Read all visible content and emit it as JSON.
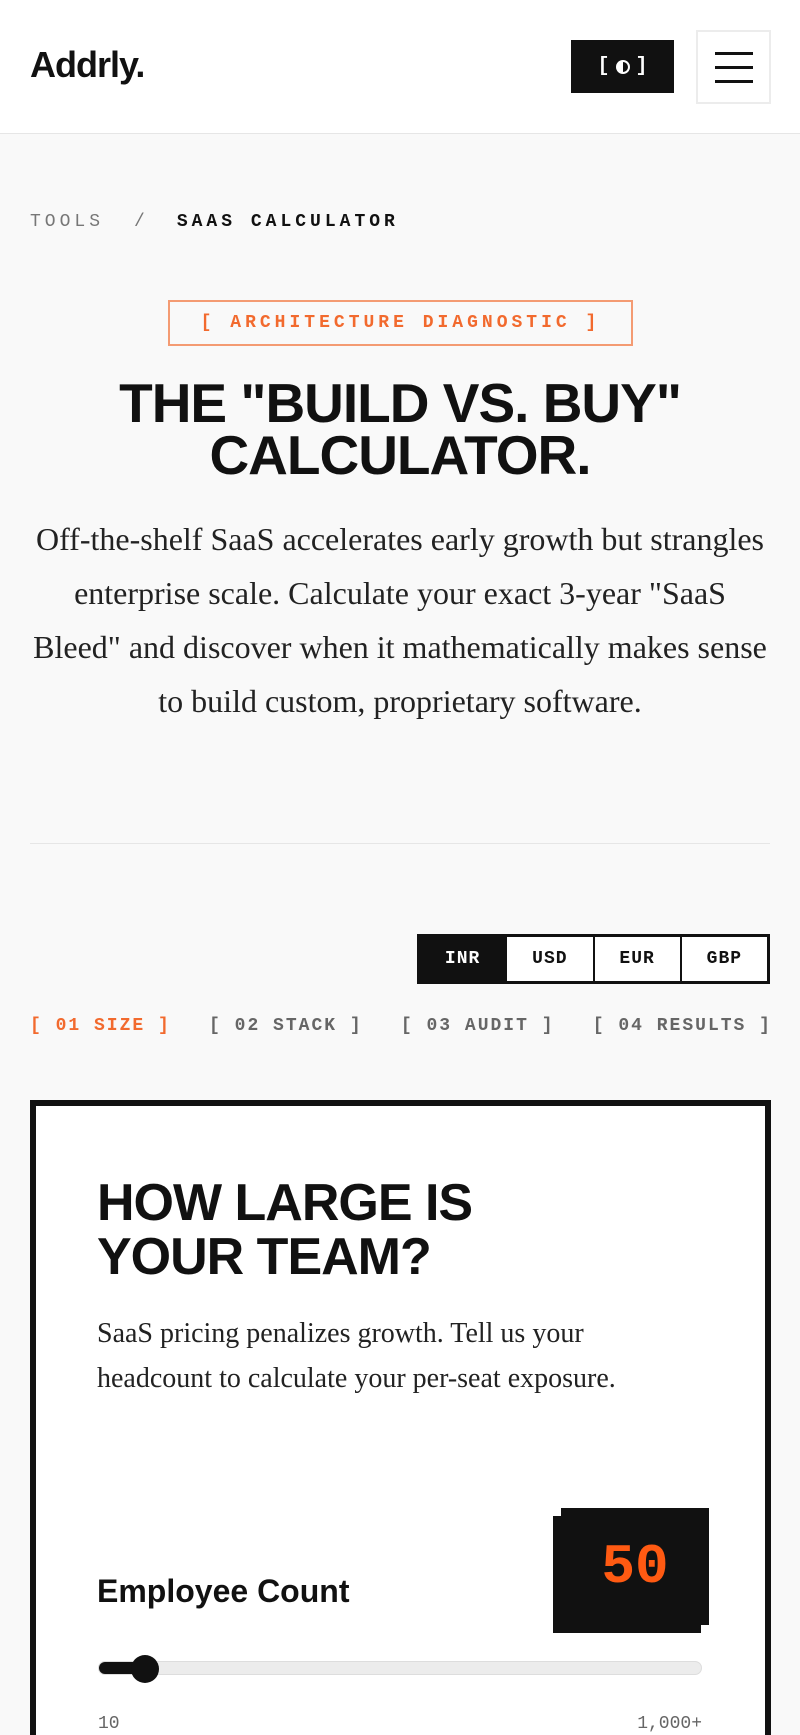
{
  "header": {
    "logo": "Addrly.",
    "theme_toggle_left": "[",
    "theme_toggle_right": "]",
    "menu_icon": "hamburger-icon"
  },
  "breadcrumb": {
    "items": [
      "TOOLS",
      "SAAS CALCULATOR"
    ],
    "separator": "/"
  },
  "hero": {
    "tag": "[ ARCHITECTURE DIAGNOSTIC ]",
    "title_line1": "THE \"BUILD VS. BUY\"",
    "title_line2": "CALCULATOR.",
    "description": "Off-the-shelf SaaS accelerates early growth but strangles enterprise scale. Calculate your exact 3-year \"SaaS Bleed\" and discover when it mathematically makes sense to build custom, proprietary software."
  },
  "currency": {
    "options": [
      "INR",
      "USD",
      "EUR",
      "GBP"
    ],
    "selected": "INR"
  },
  "steps": [
    {
      "label": "[ 01 SIZE ]",
      "active": true
    },
    {
      "label": "[ 02 STACK ]",
      "active": false
    },
    {
      "label": "[ 03 AUDIT ]",
      "active": false
    },
    {
      "label": "[ 04 RESULTS ]",
      "active": false
    }
  ],
  "card": {
    "title_line1": "HOW LARGE IS",
    "title_line2": "YOUR TEAM?",
    "description": "SaaS pricing penalizes growth. Tell us your headcount to calculate your per-seat exposure.",
    "field_label": "Employee Count",
    "value": "50",
    "slider": {
      "min_label": "10",
      "max_label": "1,000+",
      "fraction": 0.05
    }
  },
  "colors": {
    "accent": "#f26a2e",
    "value_text": "#ff5a12",
    "dark": "#111111",
    "background": "#f9f9f9"
  }
}
